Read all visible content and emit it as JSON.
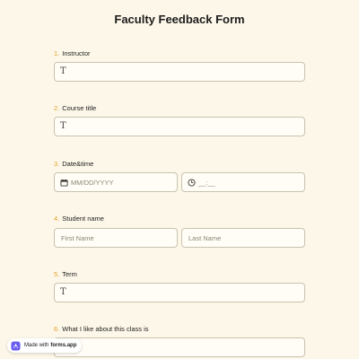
{
  "form": {
    "title": "Faculty Feedback Form"
  },
  "questions": [
    {
      "number": "1.",
      "label": "Instructor",
      "type": "text"
    },
    {
      "number": "2.",
      "label": "Course title",
      "type": "text"
    },
    {
      "number": "3.",
      "label": "Date&time",
      "type": "datetime",
      "date_placeholder": "MM/DD/YYYY",
      "time_placeholder": "__:__"
    },
    {
      "number": "4.",
      "label": "Student name",
      "type": "name",
      "first_placeholder": "First Name",
      "last_placeholder": "Last Name"
    },
    {
      "number": "5.",
      "label": "Term",
      "type": "text"
    },
    {
      "number": "6.",
      "label": "What I like about this class is",
      "type": "text"
    }
  ],
  "text_input_icon": "T",
  "badge": {
    "prefix": "Made with",
    "brand": "forms.app"
  },
  "colors": {
    "background": "#fdf7e9",
    "accent_number": "#e2a22b",
    "input_border": "#c9c2b0",
    "input_fill": "#fffdf6",
    "brand": "#6b5cf0"
  },
  "icons": {
    "text": "text-type-icon",
    "date": "calendar-icon",
    "time": "clock-icon",
    "badge": "forms-app-logo-icon"
  }
}
